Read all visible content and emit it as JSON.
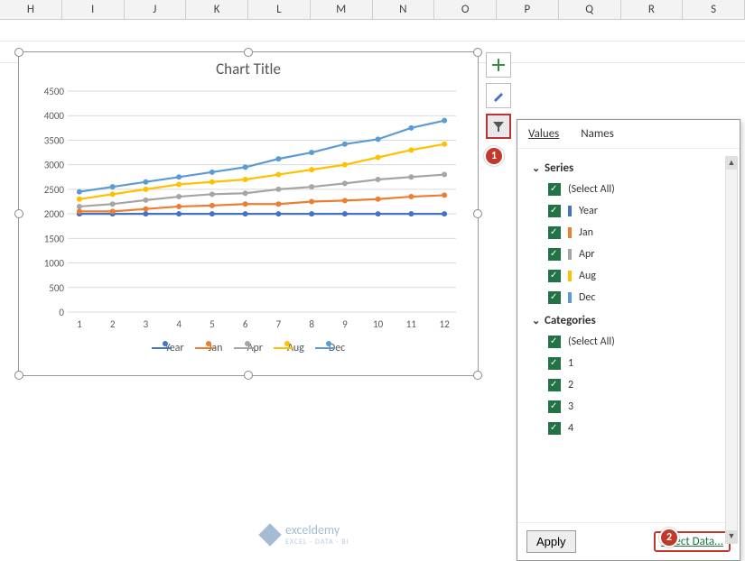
{
  "columns": [
    "H",
    "I",
    "J",
    "K",
    "L",
    "M",
    "N",
    "O",
    "P",
    "Q",
    "R",
    "S"
  ],
  "chart": {
    "title": "Chart Title"
  },
  "legend": [
    {
      "name": "Year",
      "color": "#4472c4"
    },
    {
      "name": "Jan",
      "color": "#ed7d31"
    },
    {
      "name": "Apr",
      "color": "#a5a5a5"
    },
    {
      "name": "Aug",
      "color": "#ffc000"
    },
    {
      "name": "Dec",
      "color": "#5b9bd5"
    }
  ],
  "chart_data": {
    "type": "line",
    "title": "Chart Title",
    "xlabel": "",
    "ylabel": "",
    "ylim": [
      0,
      4500
    ],
    "categories": [
      1,
      2,
      3,
      4,
      5,
      6,
      7,
      8,
      9,
      10,
      11,
      12
    ],
    "series": [
      {
        "name": "Year",
        "color": "#4472c4",
        "values": [
          2000,
          2000,
          2000,
          2000,
          2000,
          2000,
          2000,
          2000,
          2000,
          2000,
          2000,
          2000
        ]
      },
      {
        "name": "Jan",
        "color": "#ed7d31",
        "values": [
          2050,
          2050,
          2100,
          2150,
          2170,
          2200,
          2200,
          2250,
          2270,
          2300,
          2350,
          2380
        ]
      },
      {
        "name": "Apr",
        "color": "#a5a5a5",
        "values": [
          2150,
          2200,
          2280,
          2350,
          2400,
          2420,
          2500,
          2550,
          2620,
          2700,
          2750,
          2800
        ]
      },
      {
        "name": "Aug",
        "color": "#ffc000",
        "values": [
          2300,
          2400,
          2500,
          2600,
          2650,
          2700,
          2800,
          2900,
          3000,
          3150,
          3300,
          3420
        ]
      },
      {
        "name": "Dec",
        "color": "#5b9bd5",
        "values": [
          2450,
          2550,
          2650,
          2750,
          2850,
          2950,
          3120,
          3250,
          3420,
          3520,
          3750,
          3900
        ]
      }
    ],
    "yticks": [
      0,
      500,
      1000,
      1500,
      2000,
      2500,
      3000,
      3500,
      4000,
      4500
    ]
  },
  "filter_popup": {
    "tabs": {
      "values": "Values",
      "names": "Names"
    },
    "series_label": "Series",
    "categories_label": "Categories",
    "select_all": "(Select All)",
    "series_items": [
      {
        "label": "Year",
        "color": "#4472c4"
      },
      {
        "label": "Jan",
        "color": "#ed7d31"
      },
      {
        "label": "Apr",
        "color": "#a5a5a5"
      },
      {
        "label": "Aug",
        "color": "#ffc000"
      },
      {
        "label": "Dec",
        "color": "#5b9bd5"
      }
    ],
    "category_items": [
      "1",
      "2",
      "3",
      "4"
    ],
    "apply": "Apply",
    "select_data": "Select Data..."
  },
  "callouts": {
    "c1": "1",
    "c2": "2"
  },
  "watermark": {
    "brand": "exceldemy",
    "sub": "EXCEL · DATA · BI"
  }
}
